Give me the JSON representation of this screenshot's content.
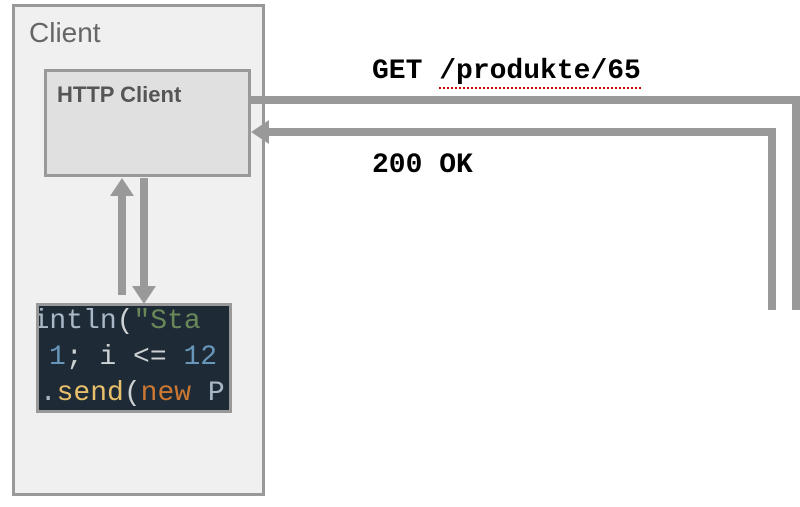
{
  "client": {
    "label": "Client",
    "http_client_label": "HTTP Client"
  },
  "http": {
    "request_line": "GET /produkte/65",
    "request_method": "GET ",
    "request_path_underlined": "/produkte/65",
    "response_line": "200 OK"
  },
  "code": {
    "line1_a": "println",
    "line1_b": "(",
    "line1_c": "\"Sta",
    "line2_a": "1",
    "line2_b": "; i ",
    "line2_c": "<=",
    "line2_d": " 12",
    "line3_a": "r.",
    "line3_b": "send",
    "line3_c": "(",
    "line3_d": "new ",
    "line3_e": "P"
  }
}
